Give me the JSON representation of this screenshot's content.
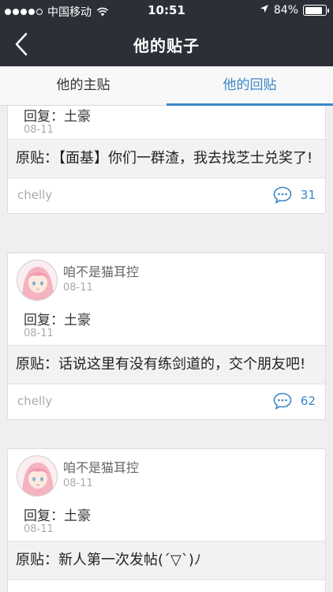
{
  "status_bar": {
    "carrier": "中国移动",
    "time": "10:51",
    "battery": "84%",
    "battery_level": 0.84
  },
  "nav": {
    "title": "他的贴子"
  },
  "tabs": [
    {
      "label": "他的主贴",
      "active": false
    },
    {
      "label": "他的回贴",
      "active": true
    }
  ],
  "colors": {
    "accent": "#3b87c8",
    "header_bg": "#2b3038"
  },
  "posts": [
    {
      "reply_text": "回复：土豪",
      "reply_date": "08-11",
      "quote": "原贴：【面基】你们一群渣，我去找芝士兑奖了!",
      "forum": "chelly",
      "comment_count": "31"
    },
    {
      "username": "咱不是猫耳控",
      "date": "08-11",
      "reply_text": "回复：土豪",
      "reply_date": "08-11",
      "quote": "原贴：话说这里有没有练剑道的，交个朋友吧!",
      "forum": "chelly",
      "comment_count": "62"
    },
    {
      "username": "咱不是猫耳控",
      "date": "08-11",
      "reply_text": "回复：土豪",
      "reply_date": "08-11",
      "quote": "原贴：新人第一次发帖(´▽`)ﾉ"
    }
  ]
}
